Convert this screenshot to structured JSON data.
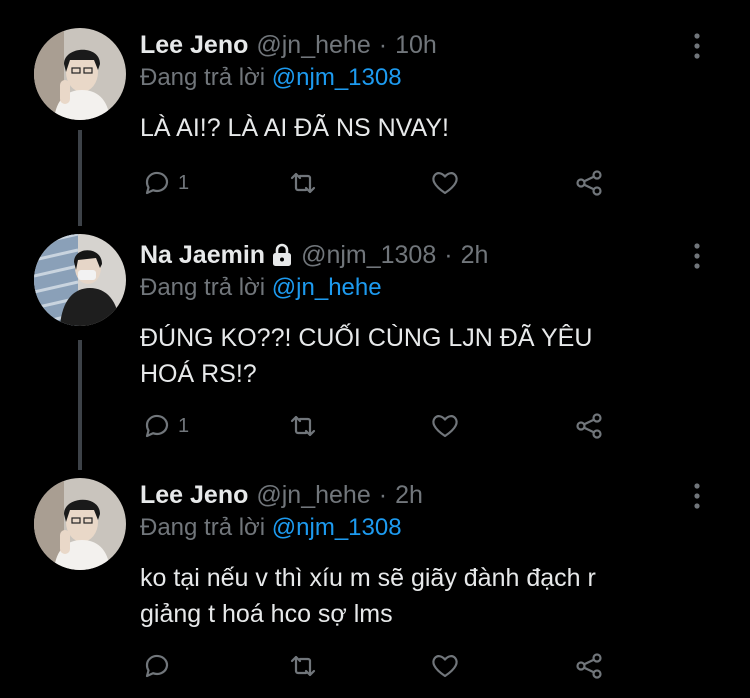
{
  "colors": {
    "background": "#000000",
    "thread_line": "#3d4248",
    "muted": "#71767b",
    "mention": "#1d9bf0",
    "text": "#e7e9ea"
  },
  "replying_prefix": "Đang trả lời",
  "tweets": [
    {
      "name": "Lee Jeno",
      "handle": "@jn_hehe",
      "dot": "·",
      "time": "10h",
      "locked": false,
      "replying_to": "@njm_1308",
      "text_lines": [
        "LÀ AI!? LÀ AI ĐÃ NS NVAY!"
      ],
      "reply_count": "1",
      "icons": [
        "reply-icon",
        "retweet-icon",
        "like-icon",
        "share-icon",
        "more-icon"
      ]
    },
    {
      "name": "Na Jaemin",
      "handle": "@njm_1308",
      "dot": "·",
      "time": "2h",
      "locked": true,
      "replying_to": "@jn_hehe",
      "text_lines": [
        "ĐÚNG KO??! CUỐI CÙNG LJN ĐÃ YÊU",
        "HOÁ RS!?"
      ],
      "reply_count": "1",
      "icons": [
        "reply-icon",
        "retweet-icon",
        "like-icon",
        "share-icon",
        "more-icon",
        "lock-icon"
      ]
    },
    {
      "name": "Lee Jeno",
      "handle": "@jn_hehe",
      "dot": "·",
      "time": "2h",
      "locked": false,
      "replying_to": "@njm_1308",
      "text_lines": [
        "ko tại nếu v thì xíu m sẽ giãy đành đạch r",
        "giảng t hoá hco sợ lms"
      ],
      "reply_count": "",
      "icons": [
        "reply-icon",
        "retweet-icon",
        "like-icon",
        "share-icon",
        "more-icon"
      ]
    }
  ]
}
